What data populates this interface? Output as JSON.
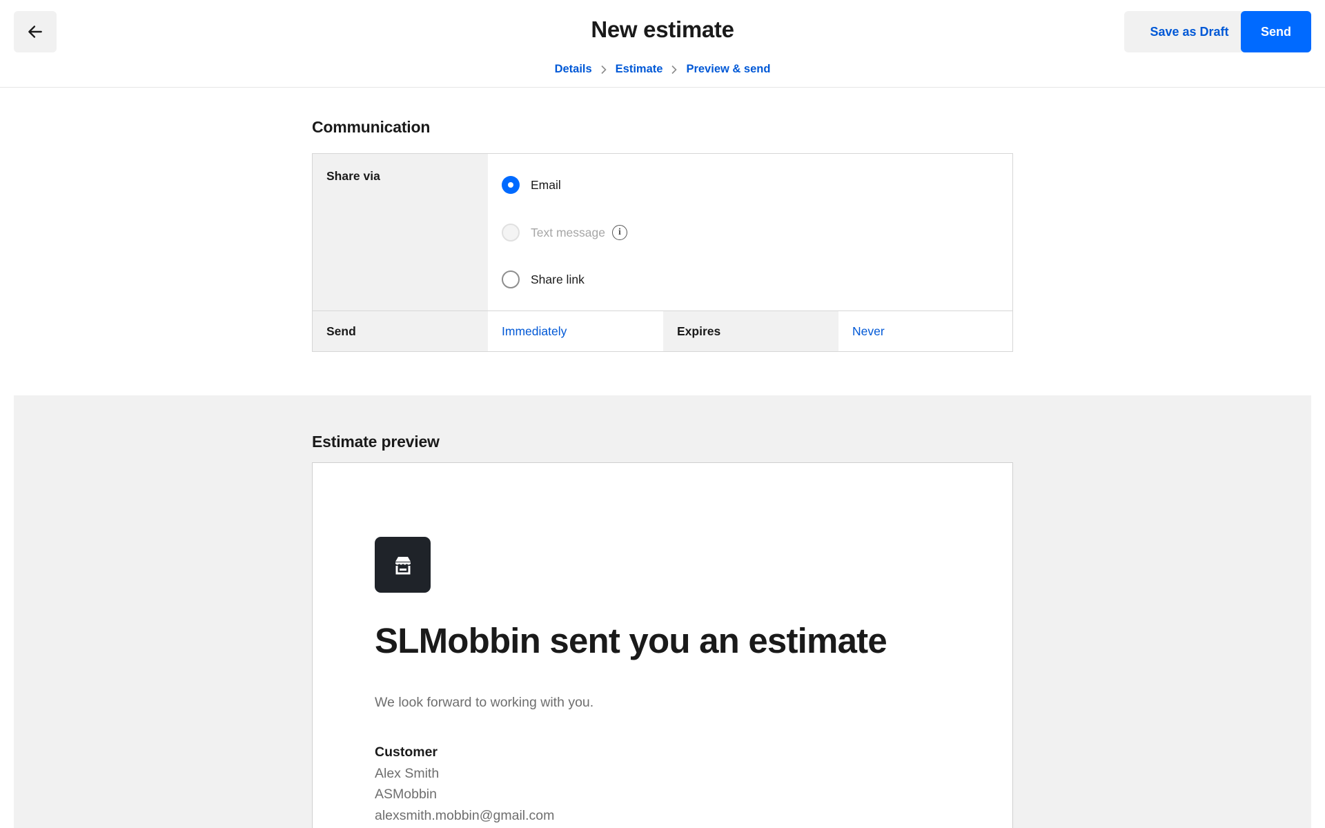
{
  "header": {
    "title": "New estimate",
    "breadcrumb": [
      "Details",
      "Estimate",
      "Preview & send"
    ],
    "save_draft_label": "Save as Draft",
    "send_label": "Send"
  },
  "communication": {
    "title": "Communication",
    "share_via_label": "Share via",
    "options": [
      {
        "label": "Email",
        "state": "checked"
      },
      {
        "label": "Text message",
        "state": "disabled"
      },
      {
        "label": "Share link",
        "state": "unchecked"
      }
    ],
    "send_label": "Send",
    "send_value": "Immediately",
    "expires_label": "Expires",
    "expires_value": "Never"
  },
  "preview": {
    "title": "Estimate preview",
    "heading": "SLMobbin sent you an estimate",
    "message": "We look forward to working with you.",
    "customer_title": "Customer",
    "customer_lines": [
      "Alex Smith",
      "ASMobbin",
      "alexsmith.mobbin@gmail.com"
    ]
  },
  "colors": {
    "accent": "#006aff",
    "link": "#0058d6",
    "panel": "#f1f1f1",
    "logo_bg": "#1f2329"
  }
}
